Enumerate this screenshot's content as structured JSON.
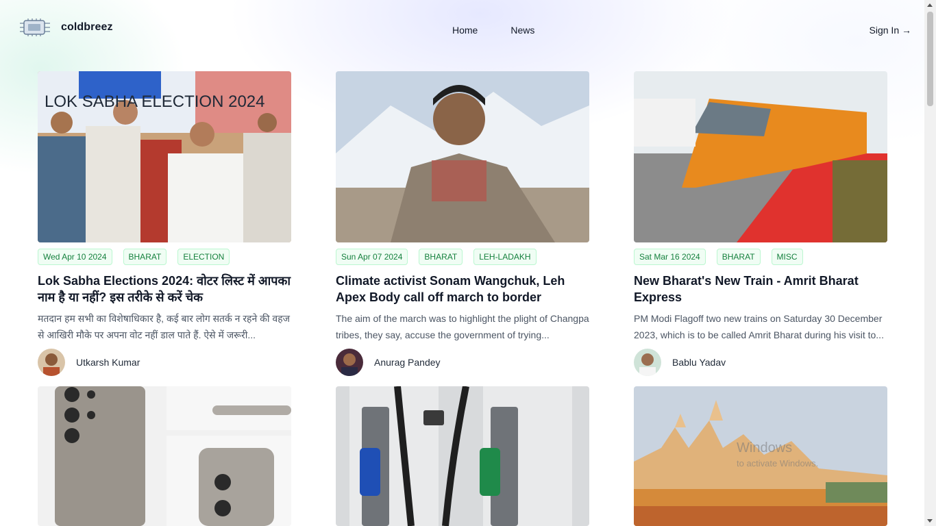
{
  "site": {
    "name": "coldbreez",
    "logo_icon": "circuit-chip-icon"
  },
  "nav": {
    "items": [
      {
        "label": "Home"
      },
      {
        "label": "News"
      }
    ],
    "signin": "Sign In →"
  },
  "cards": [
    {
      "image_icon": "election-rally-photo",
      "date": "Wed Apr 10 2024",
      "tags": [
        "BHARAT",
        "ELECTION"
      ],
      "title": "Lok Sabha Elections 2024: वोटर लिस्ट में आपका नाम है या नहीं? इस तरीके से करें चेक",
      "excerpt": "मतदान हम सभी का विशेषाधिकार है, कई बार लोग सतर्क न रहने की वहज से आखिरी मौके पर अपना वोट नहीं डाल पाते हैं. ऐसे में जरूरी...",
      "author": "Utkarsh Kumar",
      "image_text": "LOK SABHA ELECTION 2024"
    },
    {
      "image_icon": "activist-portrait-photo",
      "date": "Sun Apr 07 2024",
      "tags": [
        "BHARAT",
        "LEH-LADAKH"
      ],
      "title": "Climate activist Sonam Wangchuk, Leh Apex Body call off march to border",
      "excerpt": "The aim of the march was to highlight the plight of Changpa tribes, they say, accuse the government of trying...",
      "author": "Anurag Pandey"
    },
    {
      "image_icon": "train-photo",
      "date": "Sat Mar 16 2024",
      "tags": [
        "BHARAT",
        "MISC"
      ],
      "title": "New Bharat's New Train - Amrit Bharat Express",
      "excerpt": "PM Modi Flagoff  two new trains on Saturday 30 December 2023, which is to be called Amrit Bharat during his visit to...",
      "author": "Bablu Yadav"
    },
    {
      "image_icon": "smartphone-photo"
    },
    {
      "image_icon": "fuel-pump-photo"
    },
    {
      "image_icon": "temple-photo"
    }
  ],
  "watermark": {
    "line1": "Windows",
    "line2": "to activate Windows."
  }
}
